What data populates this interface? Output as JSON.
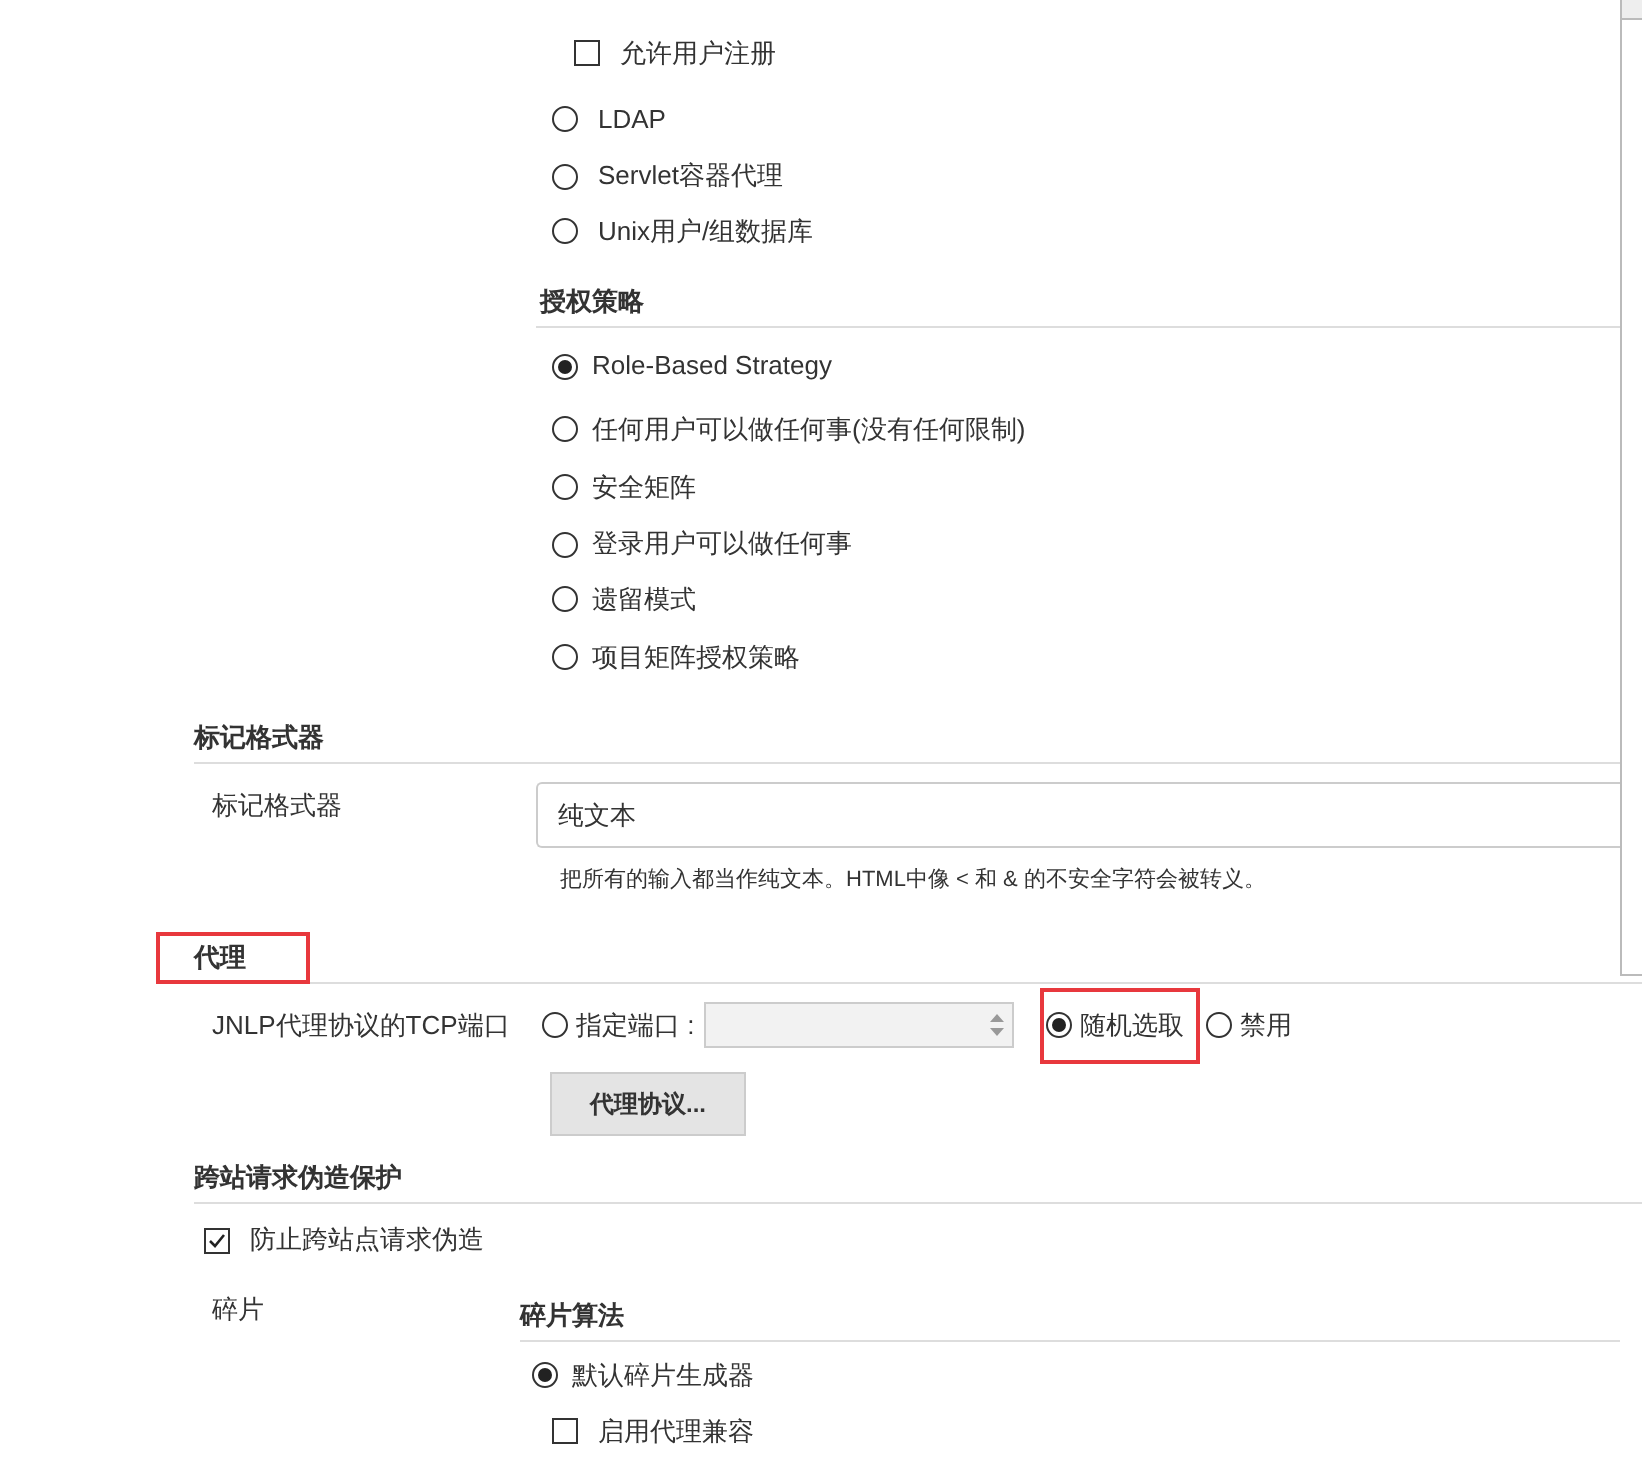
{
  "security_realm": {
    "options": [
      {
        "kind": "checkbox",
        "label": "允许用户注册",
        "checked": false
      },
      {
        "kind": "radio",
        "label": "LDAP",
        "selected": false
      },
      {
        "kind": "radio",
        "label": "Servlet容器代理",
        "selected": false
      },
      {
        "kind": "radio",
        "label": "Unix用户/组数据库",
        "selected": false
      }
    ]
  },
  "authorization": {
    "title": "授权策略",
    "options": [
      {
        "label": "Role-Based Strategy",
        "selected": true
      },
      {
        "label": "任何用户可以做任何事(没有任何限制)",
        "selected": false
      },
      {
        "label": "安全矩阵",
        "selected": false
      },
      {
        "label": "登录用户可以做任何事",
        "selected": false
      },
      {
        "label": "遗留模式",
        "selected": false
      },
      {
        "label": "项目矩阵授权策略",
        "selected": false
      }
    ]
  },
  "markup": {
    "title": "标记格式器",
    "label": "标记格式器",
    "value": "纯文本",
    "help": "把所有的输入都当作纯文本。HTML中像 < 和 & 的不安全字符会被转义。"
  },
  "agent": {
    "title": "代理",
    "highlighted": true,
    "port_label": "JNLP代理协议的TCP端口",
    "port_options": [
      {
        "kind": "radio_with_input",
        "label": "指定端口 :",
        "selected": false,
        "highlighted": false
      },
      {
        "kind": "radio",
        "label": "随机选取",
        "selected": true,
        "highlighted": true
      },
      {
        "kind": "radio",
        "label": "禁用",
        "selected": false,
        "highlighted": false
      }
    ],
    "button": "代理协议..."
  },
  "csrf": {
    "title": "跨站请求伪造保护",
    "option": {
      "label": "防止跨站点请求伪造",
      "checked": true
    },
    "crumb_label": "碎片",
    "algorithm_title": "碎片算法",
    "algorithm": {
      "label": "默认碎片生成器",
      "selected": true
    },
    "proxy_compat": {
      "label": "启用代理兼容",
      "checked": false
    }
  }
}
